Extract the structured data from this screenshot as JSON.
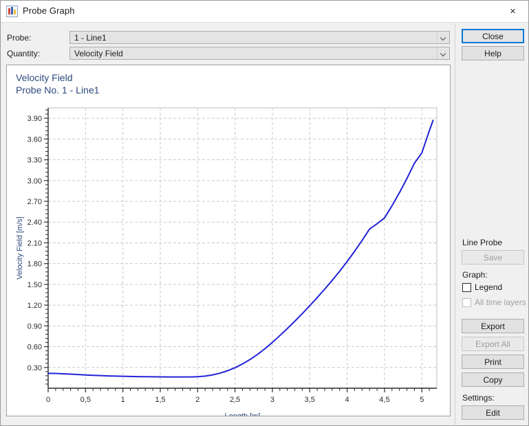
{
  "window": {
    "title": "Probe Graph",
    "icon": "chart-icon",
    "close_glyph": "×"
  },
  "form": {
    "probe_label": "Probe:",
    "probe_value": "1 - Line1",
    "quantity_label": "Quantity:",
    "quantity_value": "Velocity Field"
  },
  "sidebar": {
    "close_label": "Close",
    "help_label": "Help",
    "line_probe_label": "Line Probe",
    "save_label": "Save",
    "graph_label": "Graph:",
    "legend_label": "Legend",
    "legend_checked": false,
    "all_time_layers_label": "All time layers",
    "all_time_layers_checked": false,
    "export_label": "Export",
    "export_all_label": "Export All",
    "print_label": "Print",
    "copy_label": "Copy",
    "settings_label": "Settings:",
    "edit_label": "Edit"
  },
  "chart_data": {
    "type": "line",
    "title": "Velocity Field",
    "subtitle": "Probe No. 1 - Line1",
    "xlabel": "Length [m]",
    "ylabel": "Velocity Field [m/s]",
    "xlim": [
      0,
      5.2
    ],
    "ylim": [
      0,
      4.05
    ],
    "grid": true,
    "legend_position": "none",
    "line_color": "#2222d8",
    "title_color": "#2c4a7c",
    "axis_text_color": "#2b2b2b",
    "axis_label_color": "#2c4a7c",
    "xticks": [
      0,
      0.5,
      1,
      1.5,
      2,
      2.5,
      3,
      3.5,
      4,
      4.5,
      5
    ],
    "xticklabels": [
      "0",
      "0,5",
      "1",
      "1,5",
      "2",
      "2,5",
      "3",
      "3,5",
      "4",
      "4,5",
      "5"
    ],
    "yticks": [
      0.3,
      0.6,
      0.9,
      1.2,
      1.5,
      1.8,
      2.1,
      2.4,
      2.7,
      3.0,
      3.3,
      3.6,
      3.9
    ],
    "yticklabels": [
      "0.30",
      "0.60",
      "0.90",
      "1.20",
      "1.50",
      "1.80",
      "2.10",
      "2.40",
      "2.70",
      "3.00",
      "3.30",
      "3.60",
      "3.90"
    ],
    "minor_ticks_per_major": 5,
    "series": [
      {
        "name": "Velocity Field",
        "x": [
          0.0,
          0.1,
          0.2,
          0.3,
          0.4,
          0.5,
          0.6,
          0.7,
          0.8,
          0.9,
          1.0,
          1.1,
          1.2,
          1.3,
          1.4,
          1.5,
          1.6,
          1.7,
          1.8,
          1.9,
          2.0,
          2.1,
          2.2,
          2.3,
          2.4,
          2.5,
          2.6,
          2.7,
          2.8,
          2.9,
          3.0,
          3.1,
          3.2,
          3.3,
          3.4,
          3.5,
          3.6,
          3.7,
          3.8,
          3.9,
          4.0,
          4.1,
          4.2,
          4.3,
          4.4,
          4.5,
          4.6,
          4.7,
          4.8,
          4.9,
          5.0,
          5.05,
          5.1,
          5.15
        ],
        "y": [
          0.215,
          0.213,
          0.209,
          0.203,
          0.197,
          0.191,
          0.186,
          0.182,
          0.178,
          0.175,
          0.172,
          0.17,
          0.168,
          0.166,
          0.165,
          0.164,
          0.163,
          0.163,
          0.162,
          0.163,
          0.166,
          0.175,
          0.192,
          0.218,
          0.252,
          0.296,
          0.35,
          0.414,
          0.487,
          0.57,
          0.662,
          0.76,
          0.862,
          0.968,
          1.078,
          1.192,
          1.31,
          1.432,
          1.558,
          1.69,
          1.83,
          1.978,
          2.135,
          2.3,
          2.375,
          2.46,
          2.635,
          2.825,
          3.03,
          3.25,
          3.4,
          3.56,
          3.72,
          3.87
        ]
      }
    ]
  }
}
